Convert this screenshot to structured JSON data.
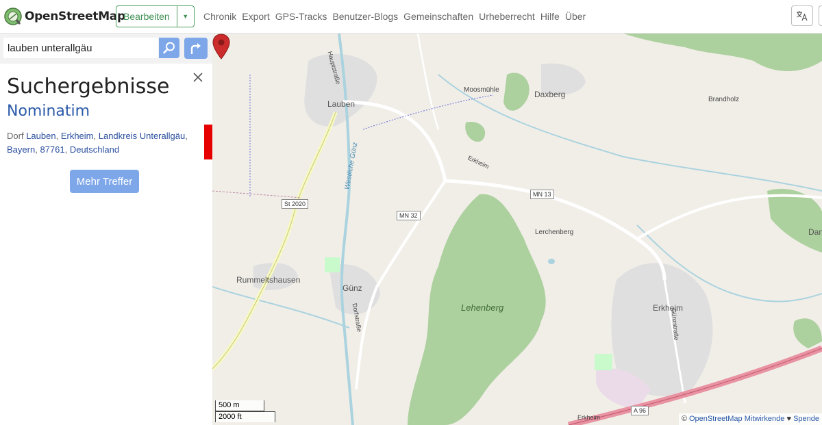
{
  "header": {
    "logo_text": "OpenStreetMap",
    "edit_label": "Bearbeiten",
    "nav": [
      "Chronik",
      "Export",
      "GPS-Tracks",
      "Benutzer-Blogs",
      "Gemeinschaften",
      "Urheberrecht",
      "Hilfe",
      "Über"
    ]
  },
  "search": {
    "value": "lauben unterallgäu"
  },
  "results": {
    "title": "Suchergebnisse",
    "provider": "Nominatim",
    "item": {
      "type": "Dorf",
      "place": "Lauben",
      "parts": [
        "Erkheim",
        "Landkreis Unterallgäu",
        "Bayern",
        "87761",
        "Deutschland"
      ]
    },
    "more_label": "Mehr Treffer"
  },
  "map": {
    "places": {
      "lauben": "Lauben",
      "moosmuehle": "Moosmühle",
      "daxberg": "Daxberg",
      "brandholz": "Brandholz",
      "lerchenberg": "Lerchenberg",
      "rummeltshausen": "Rummeltshausen",
      "guenz": "Günz",
      "erkheim": "Erkheim",
      "erkheim2": "Erkheim",
      "danke": "Danke",
      "lehenberg": "Lehenberg",
      "westliche_guenz": "Westliche Günz",
      "hauptstrasse": "Hauptstraße",
      "dorfstrasse": "Dorfstraße",
      "guenzstrasse": "Günzstraße",
      "erkheim_road": "Erkheim"
    },
    "shields": {
      "st2020": "St 2020",
      "mn32": "MN 32",
      "mn13": "MN 13",
      "a96": "A 96"
    },
    "scale": {
      "metric": "500 m",
      "imperial": "2000 ft"
    },
    "attribution": {
      "prefix": "©",
      "link": "OpenStreetMap Mitwirkende",
      "heart": "♥",
      "donate": "Spende"
    }
  },
  "colors": {
    "accent": "#7ea7e9",
    "edit_green": "#3f8f52",
    "marker_red": "#e60000",
    "forest": "#add19e",
    "water": "#aad3df"
  }
}
